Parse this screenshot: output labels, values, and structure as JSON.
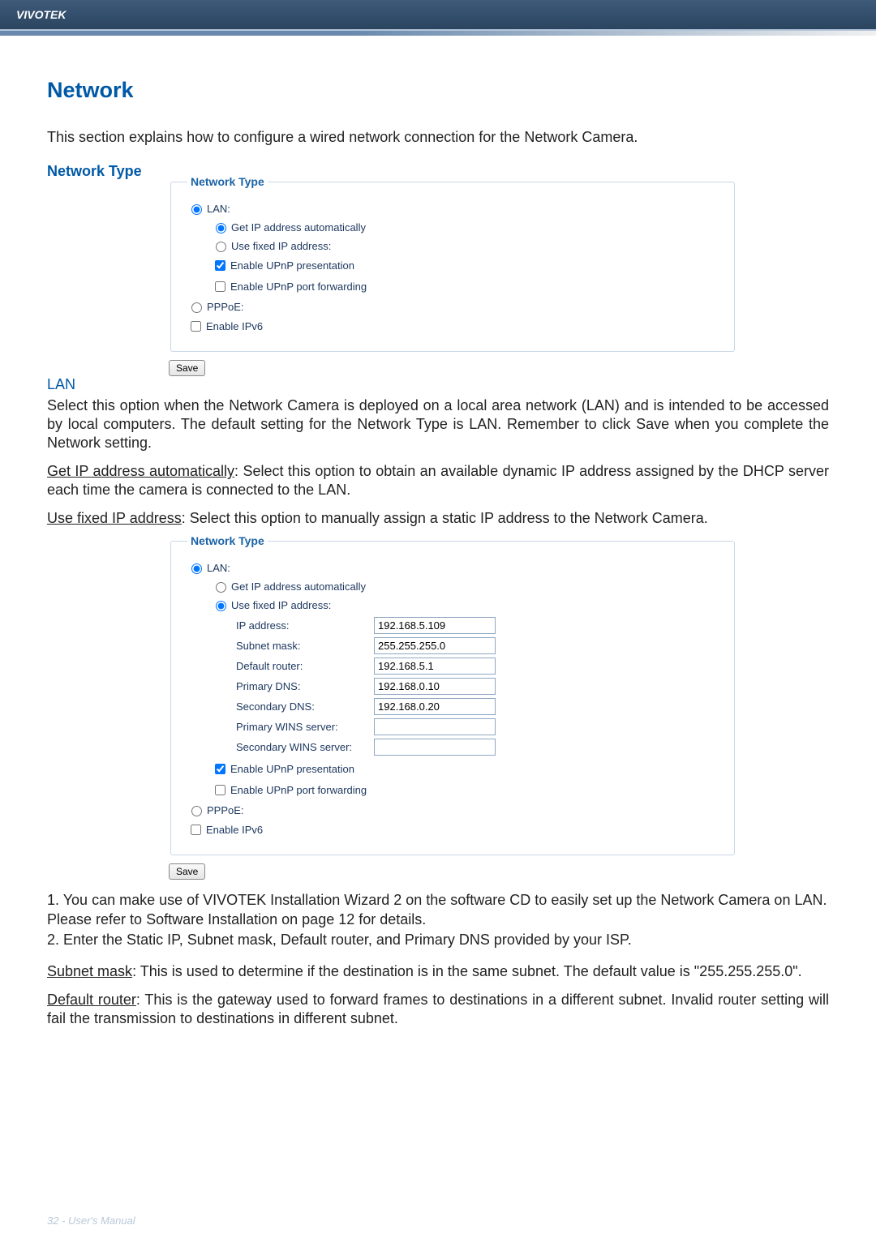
{
  "header": {
    "brand": "VIVOTEK"
  },
  "title": "Network",
  "intro": "This section explains how to configure a wired network connection for the Network Camera.",
  "section_network_type": "Network Type",
  "panel1": {
    "legend": "Network Type",
    "lan": "LAN:",
    "get_auto": "Get IP address automatically",
    "use_fixed": "Use fixed IP address:",
    "upnp_pres": "Enable UPnP presentation",
    "upnp_port": "Enable UPnP port forwarding",
    "pppoe": "PPPoE:",
    "ipv6": "Enable IPv6",
    "save": "Save"
  },
  "lan_heading": "LAN",
  "lan_para1": "Select this option when the Network Camera is deployed on a local area network (LAN) and is intended to be accessed by local computers. The default setting for the Network Type is LAN. Remember to click Save when you complete the Network setting.",
  "lan_save_word": "Save",
  "get_ip_label": "Get IP address automatically",
  "get_ip_rest": ": Select this option to obtain an available dynamic IP address assigned by the DHCP server each time the camera is connected to the LAN.",
  "use_fixed_label": "Use fixed IP address",
  "use_fixed_rest": ": Select this option to manually assign a static IP address to the Network Camera.",
  "panel2": {
    "legend": "Network Type",
    "lan": "LAN:",
    "get_auto": "Get IP address automatically",
    "use_fixed": "Use fixed IP address:",
    "ip_label": "IP address:",
    "ip_val": "192.168.5.109",
    "subnet_label": "Subnet mask:",
    "subnet_val": "255.255.255.0",
    "router_label": "Default router:",
    "router_val": "192.168.5.1",
    "pdns_label": "Primary DNS:",
    "pdns_val": "192.168.0.10",
    "sdns_label": "Secondary DNS:",
    "sdns_val": "192.168.0.20",
    "pwins_label": "Primary WINS server:",
    "pwins_val": "",
    "swins_label": "Secondary WINS server:",
    "swins_val": "",
    "upnp_pres": "Enable UPnP presentation",
    "upnp_port": "Enable UPnP port forwarding",
    "pppoe": "PPPoE:",
    "ipv6": "Enable IPv6",
    "save": "Save"
  },
  "note1": "1. You can make use of VIVOTEK Installation Wizard 2 on the software CD to easily set up the Network Camera on LAN. Please refer to Software Installation on page 12 for details.",
  "note2": "2. Enter the Static IP, Subnet mask, Default router, and Primary DNS provided by your ISP.",
  "subnet_label": "Subnet mask",
  "subnet_rest": ": This is used to determine if the destination is in the same subnet. The default value is \"255.255.255.0\".",
  "router_label": "Default router",
  "router_rest": ": This is the gateway used to forward frames to destinations in a different subnet. Invalid router setting will fail the transmission to destinations in different subnet.",
  "footer": "32 - User's Manual"
}
